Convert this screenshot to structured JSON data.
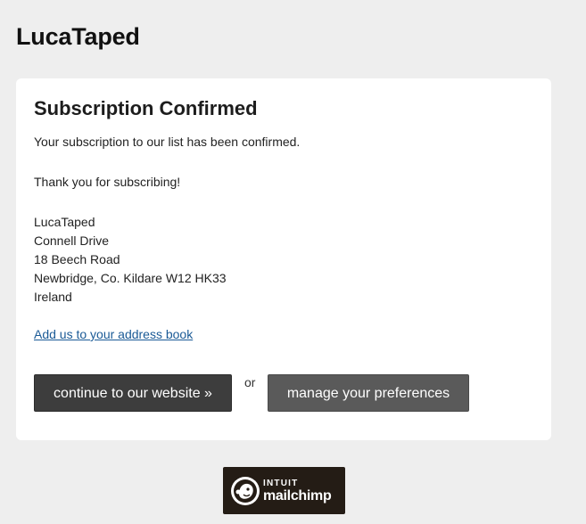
{
  "header": {
    "site_title": "LucaTaped"
  },
  "card": {
    "title": "Subscription Confirmed",
    "confirmation_text": "Your subscription to our list has been confirmed.",
    "thanks_text": "Thank you for subscribing!",
    "address_lines": [
      "LucaTaped",
      "Connell Drive",
      "18 Beech Road",
      "Newbridge, Co. Kildare W12 HK33",
      "Ireland"
    ],
    "address_book_link": "Add us to your address book",
    "website_button": "continue to our website »",
    "or_text": "or",
    "preferences_button": "manage your preferences"
  },
  "footer_badge": {
    "top_text": "INTUIT",
    "bottom_text": "mailchimp",
    "icon": "mailchimp-freddie-icon"
  },
  "colors": {
    "page_background": "#eeeeee",
    "card_background": "#ffffff",
    "link": "#1a5a96",
    "website_button": "#3d3d3d",
    "preferences_button": "#5a5a5a",
    "badge_background": "#241c15"
  }
}
